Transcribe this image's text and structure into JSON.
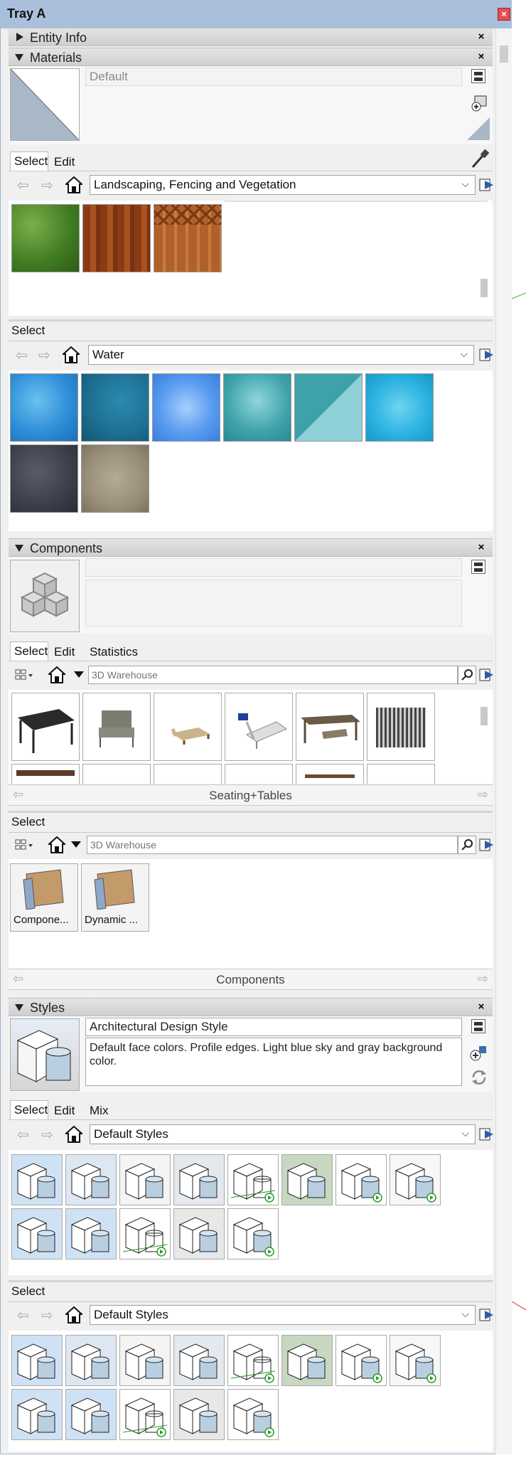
{
  "window": {
    "title": "Tray A"
  },
  "entity_info": {
    "label": "Entity Info"
  },
  "materials": {
    "label": "Materials",
    "current_name": "Default",
    "tabs": [
      "Select",
      "Edit"
    ],
    "collection1": "Landscaping, Fencing and Vegetation",
    "second_select_label": "Select",
    "collection2": "Water"
  },
  "components": {
    "label": "Components",
    "tabs": [
      "Select",
      "Edit",
      "Statistics"
    ],
    "search_placeholder": "3D Warehouse",
    "footer1": "Seating+Tables",
    "second_select_label": "Select",
    "search_placeholder2": "3D Warehouse",
    "folders": [
      "Compone...",
      "Dynamic ..."
    ],
    "footer2": "Components"
  },
  "styles": {
    "label": "Styles",
    "style_name": "Architectural Design Style",
    "style_desc": "Default face colors. Profile edges. Light blue sky and gray background color.",
    "tabs": [
      "Select",
      "Edit",
      "Mix"
    ],
    "collection1": "Default Styles",
    "second_select_label": "Select",
    "collection2": "Default Styles"
  },
  "colors": {
    "title_bar": "#a9bfdc",
    "water1": "#2f8fd8",
    "water2": "#1d6e91",
    "water3": "#5a9cf0",
    "water4": "#3fa2aa",
    "water5": "#6bbdc5",
    "water6": "#2ab1e0",
    "stone1": "#3c3e4a",
    "stone2": "#9a8f78",
    "grass": "#4f8a2a",
    "wood": "#9a4a1c",
    "fence": "#b5642a"
  }
}
